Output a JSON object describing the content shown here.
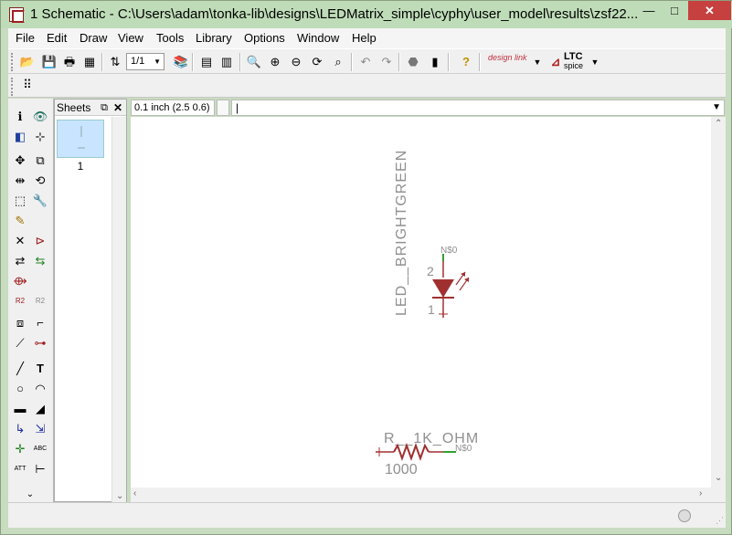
{
  "window": {
    "title": "1 Schematic - C:\\Users\\adam\\tonka-lib\\designs\\LEDMatrix_simple\\cyphy\\user_model\\results\\zsf22...",
    "minimize": "—",
    "maximize": "□",
    "close": "✕"
  },
  "menu": [
    "File",
    "Edit",
    "Draw",
    "View",
    "Tools",
    "Library",
    "Options",
    "Window",
    "Help"
  ],
  "toolbar": {
    "sheet_select": "1/1",
    "designlink": "design link",
    "ltspice_top": "LTC",
    "ltspice_bottom": "spice"
  },
  "sheets_panel": {
    "title": "Sheets",
    "pin": "⧉",
    "close": "✕",
    "thumbnail_label": "1"
  },
  "coords": {
    "grid": "0.1 inch (2.5 0.6)"
  },
  "command": {
    "value": "|"
  },
  "schematic": {
    "led_name": "LED__BRIGHTGREEN",
    "led_net": "N$0",
    "led_pin_top": "2",
    "led_pin_bottom": "1",
    "res_name": "R__1K_OHM",
    "res_net": "N$0",
    "res_value": "1000",
    "part_color": "#a03030",
    "label_color": "#909090",
    "net_color": "#30a030"
  }
}
